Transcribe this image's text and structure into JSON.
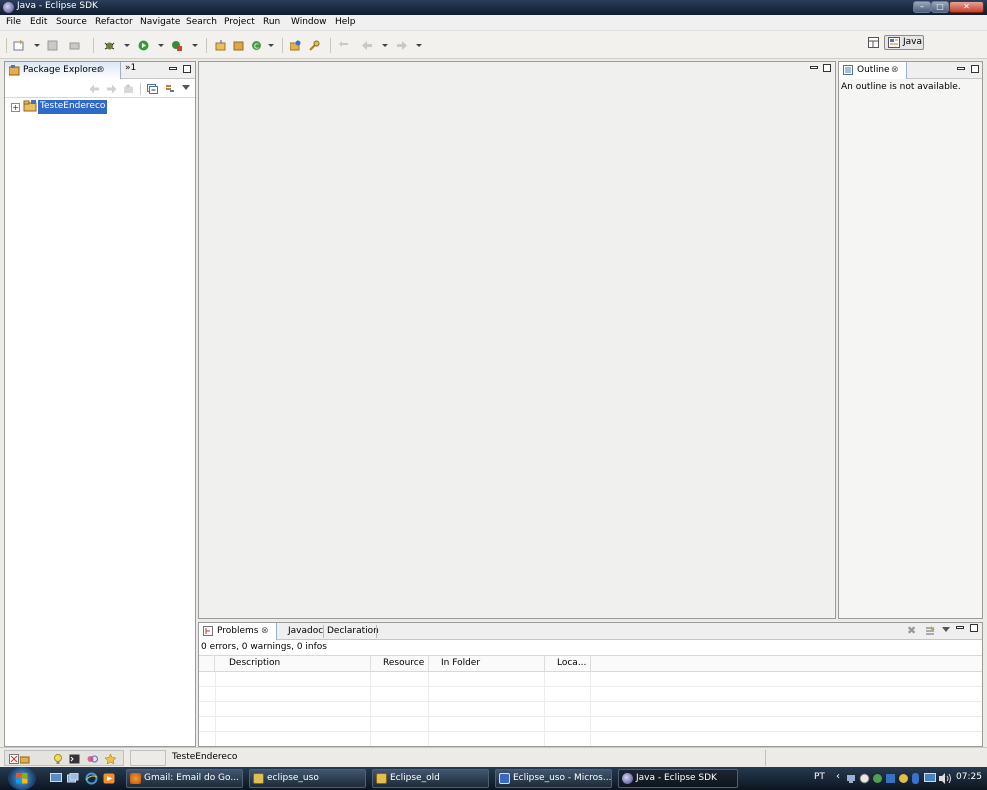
{
  "window": {
    "title": "Java - Eclipse SDK"
  },
  "menu": [
    "File",
    "Edit",
    "Source",
    "Refactor",
    "Navigate",
    "Search",
    "Project",
    "Run",
    "Window",
    "Help"
  ],
  "perspective": {
    "label": "Java"
  },
  "package_explorer": {
    "tab_label": "Package Explorer",
    "overflow_label": "»1",
    "tree": [
      {
        "label": "TesteEndereco"
      }
    ]
  },
  "outline": {
    "tab_label": "Outline",
    "message": "An outline is not available."
  },
  "problems": {
    "tabs": [
      "Problems",
      "Javadoc",
      "Declaration"
    ],
    "summary": "0 errors, 0 warnings, 0 infos",
    "columns": [
      "Description",
      "Resource",
      "In Folder",
      "Loca..."
    ]
  },
  "status": {
    "selection": "TesteEndereco"
  },
  "taskbar": {
    "tasks": [
      "Gmail: Email do Go...",
      "eclipse_uso",
      "Eclipse_old",
      "Eclipse_uso - Micros...",
      "Java - Eclipse SDK"
    ],
    "lang": "PT",
    "clock": "07:25"
  },
  "colors": {
    "selection": "#3169c6",
    "titlebar": "#1c2a40",
    "taskbar": "#1a2634"
  }
}
